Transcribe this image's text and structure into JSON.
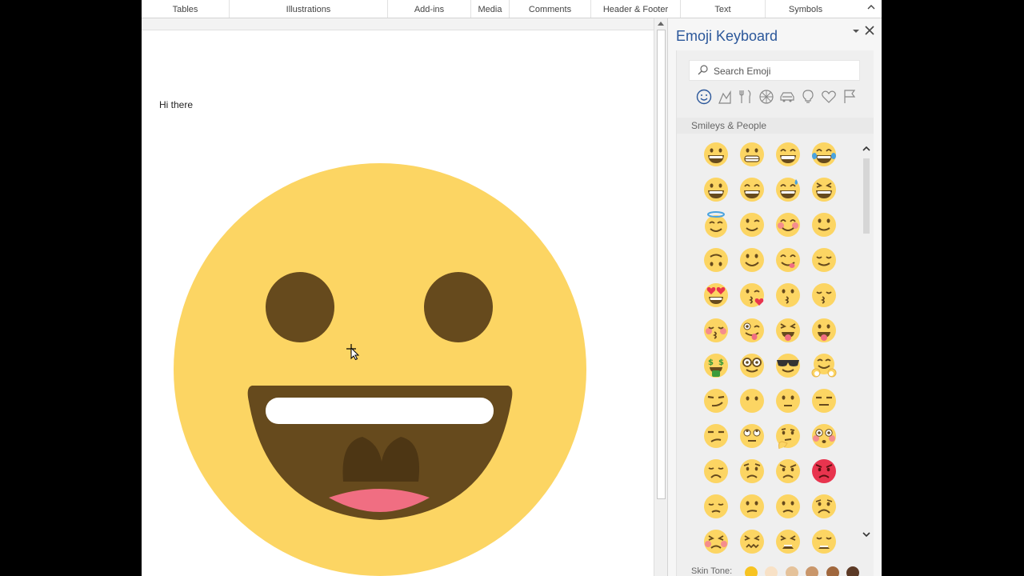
{
  "ribbon": {
    "groups": [
      "Tables",
      "Illustrations",
      "Add-ins",
      "Media",
      "Comments",
      "Header & Footer",
      "Text",
      "Symbols"
    ],
    "collapse_icon": "chevron-up-icon"
  },
  "document": {
    "text": "Hi there",
    "image_icon": "grinning-face-icon",
    "cursor_icon": "move-cursor-icon"
  },
  "pane": {
    "title": "Emoji Keyboard",
    "menu_icon": "chevron-down-icon",
    "close_icon": "close-icon",
    "search_placeholder": "Search Emoji",
    "categories": [
      "smileys",
      "nature",
      "food",
      "activity",
      "travel",
      "objects",
      "symbols",
      "flags"
    ],
    "section_label": "Smileys & People",
    "skin_tone_label": "Skin Tone:",
    "skin_tones": [
      "#f7c321",
      "#f8e1c6",
      "#e5c29a",
      "#c9966a",
      "#a0673d",
      "#5c3a26"
    ],
    "colors": {
      "accent": "#2b579a",
      "face": "#fcd563",
      "mouth": "#664a1d"
    }
  }
}
